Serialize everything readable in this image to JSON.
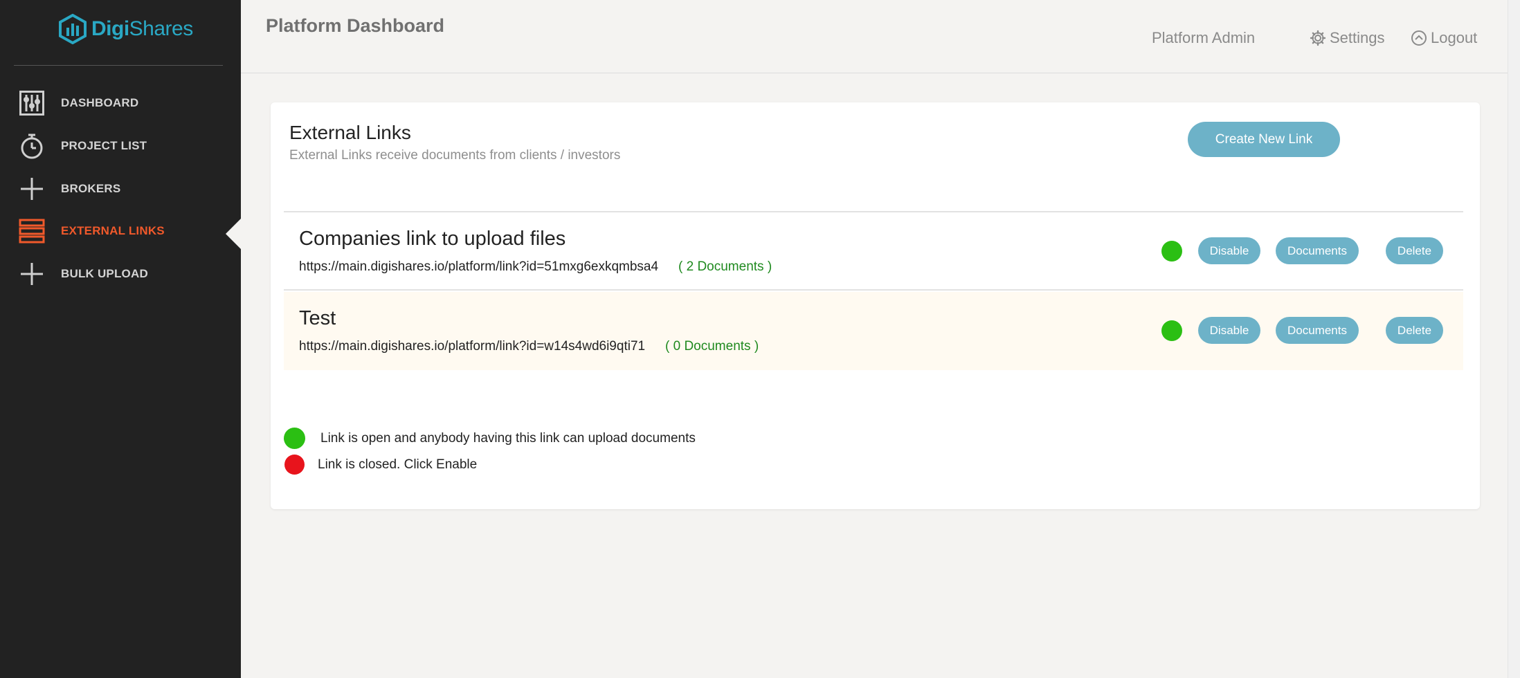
{
  "brand": {
    "name_bold": "Digi",
    "name_rest": "Shares"
  },
  "sidebar": {
    "items": [
      {
        "label": "DASHBOARD",
        "icon": "dashboard-sliders-icon"
      },
      {
        "label": "PROJECT LIST",
        "icon": "stopwatch-icon"
      },
      {
        "label": "BROKERS",
        "icon": "plus-icon"
      },
      {
        "label": "EXTERNAL LINKS",
        "icon": "stacked-list-icon",
        "active": true
      },
      {
        "label": "BULK UPLOAD",
        "icon": "plus-icon"
      }
    ]
  },
  "header": {
    "title": "Platform Dashboard",
    "user_label": "Platform Admin",
    "settings_label": "Settings",
    "logout_label": "Logout"
  },
  "external_links": {
    "title": "External Links",
    "subtitle": "External Links receive documents from clients / investors",
    "create_button": "Create New Link",
    "rows": [
      {
        "name": "Companies link to upload files",
        "url": "https://main.digishares.io/platform/link?id=51mxg6exkqmbsa4",
        "documents": "( 2 Documents )",
        "status": "open",
        "disable_label": "Disable",
        "documents_label": "Documents",
        "delete_label": "Delete"
      },
      {
        "name": "Test",
        "url": "https://main.digishares.io/platform/link?id=w14s4wd6i9qti71",
        "documents": "( 0 Documents )",
        "status": "open",
        "disable_label": "Disable",
        "documents_label": "Documents",
        "delete_label": "Delete"
      }
    ],
    "legend": {
      "open": "Link is open and anybody having this link can upload documents",
      "closed": "Link is closed. Click Enable"
    }
  },
  "colors": {
    "sidebar_bg": "#222222",
    "accent_active": "#f0592b",
    "brand_teal": "#2aa8c4",
    "button_blue": "#6db2c8",
    "status_open": "#2bbf13",
    "status_closed": "#e8141c",
    "doc_count_green": "#1f8a1f"
  }
}
